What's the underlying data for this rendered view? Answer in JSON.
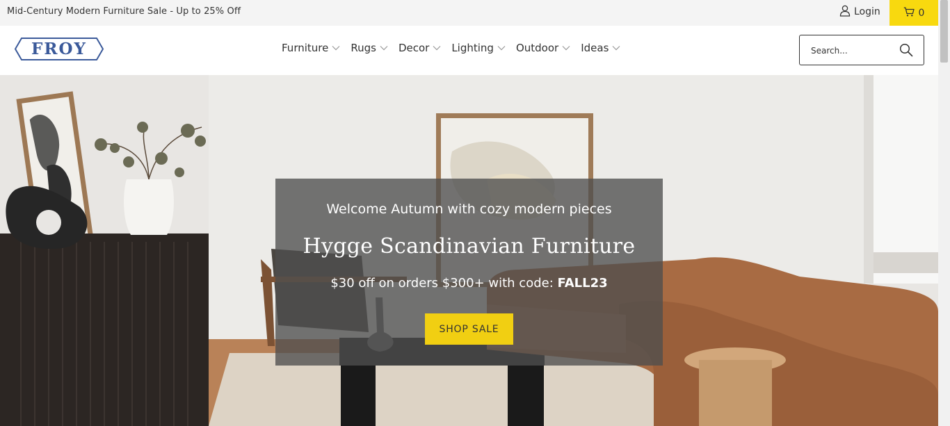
{
  "announcement": "Mid-Century Modern Furniture Sale - Up to 25% Off",
  "account": {
    "login_label": "Login",
    "icon": "user-icon"
  },
  "cart": {
    "count": "0",
    "icon": "cart-icon",
    "background": "#f8d90f"
  },
  "logo": {
    "text": "FROY",
    "color": "#3b5a9a"
  },
  "nav": {
    "items": [
      {
        "label": "Furniture"
      },
      {
        "label": "Rugs"
      },
      {
        "label": "Decor"
      },
      {
        "label": "Lighting"
      },
      {
        "label": "Outdoor"
      },
      {
        "label": "Ideas"
      }
    ]
  },
  "search": {
    "placeholder": "Search...",
    "value": "",
    "icon": "search-icon"
  },
  "hero": {
    "subtitle": "Welcome Autumn with cozy modern pieces",
    "title": "Hygge Scandinavian Furniture",
    "promo_text": "$30 off on orders $300+ with code: ",
    "promo_code": "FALL23",
    "cta_label": "SHOP SALE",
    "cta_color": "#f1cf12"
  }
}
